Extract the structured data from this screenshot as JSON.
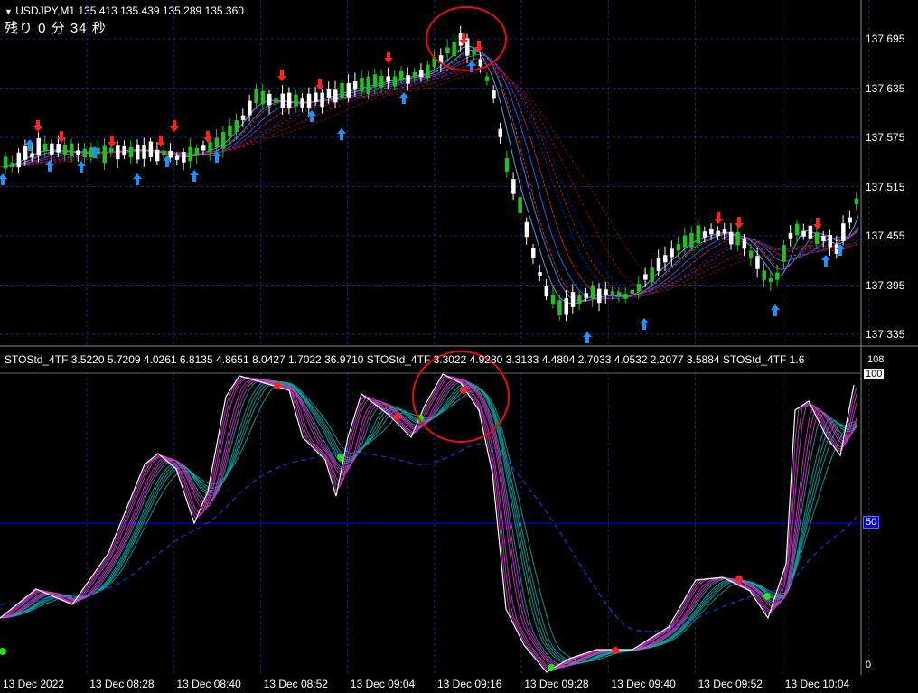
{
  "main_chart": {
    "symbol_line": "USDJPY,M1  135.413 135.439 135.289 135.360",
    "timer_text": "残り 0 分 34 秒",
    "price_ticks": [
      "137.695",
      "137.635",
      "137.575",
      "137.515",
      "137.455",
      "137.395",
      "137.335"
    ]
  },
  "indicator": {
    "header_text": "STOStd_4TF 3.5220 5.7209 4.0261 6.8135 4.8651 8.0427 1.7022 36.9710  STOStd_4TF 3.3022 4.9280 3.3133 4.4804 2.7033 4.0532 2.2077 3.5884  STOStd_4TF 1.6",
    "scale_top": "108",
    "level_100": "100",
    "level_50": "50",
    "level_0": "0"
  },
  "time_axis": [
    "13 Dec 2022",
    "13 Dec 08:28",
    "13 Dec 08:40",
    "13 Dec 08:52",
    "13 Dec 09:04",
    "13 Dec 09:16",
    "13 Dec 09:28",
    "13 Dec 09:40",
    "13 Dec 09:52",
    "13 Dec 10:04"
  ],
  "colors": {
    "background": "#000000",
    "grid": "#1e2a6e",
    "bull_candle": "#22c022",
    "bear_candle": "#ffffff",
    "up_arrow": "#1e90ff",
    "down_arrow": "#ff2020",
    "highlight_circle": "#e01010",
    "level_line": "#0000cc"
  }
}
